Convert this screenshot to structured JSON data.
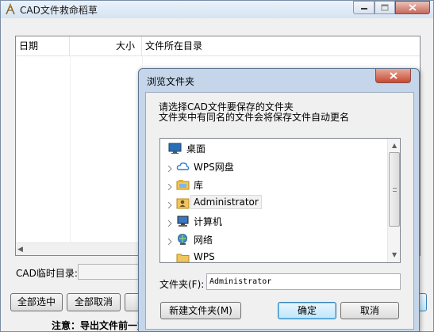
{
  "main_window": {
    "title": "CAD文件救命稻草",
    "list": {
      "columns": [
        "日期",
        "大小",
        "文件所在目录"
      ]
    },
    "temp_dir_label": "CAD临时目录:",
    "buttons": {
      "select_all": "全部选中",
      "clear_all": "全部取消"
    },
    "notice": "注意：导出文件前一定"
  },
  "browse_dialog": {
    "title": "浏览文件夹",
    "description_line1": "请选择CAD文件要保存的文件夹",
    "description_line2": "文件夹中有同名的文件会将保存文件自动更名",
    "tree_items": [
      {
        "label": "桌面",
        "icon": "desktop-icon"
      },
      {
        "label": "WPS网盘",
        "icon": "cloud-icon"
      },
      {
        "label": "库",
        "icon": "library-icon"
      },
      {
        "label": "Administrator",
        "icon": "user-folder-icon",
        "selected": true
      },
      {
        "label": "计算机",
        "icon": "computer-icon"
      },
      {
        "label": "网络",
        "icon": "network-icon"
      },
      {
        "label": "WPS",
        "icon": "folder-icon"
      }
    ],
    "folder_label": "文件夹(F):",
    "folder_value": "Administrator",
    "buttons": {
      "new_folder": "新建文件夹(M)",
      "ok": "确定",
      "cancel": "取消"
    }
  }
}
